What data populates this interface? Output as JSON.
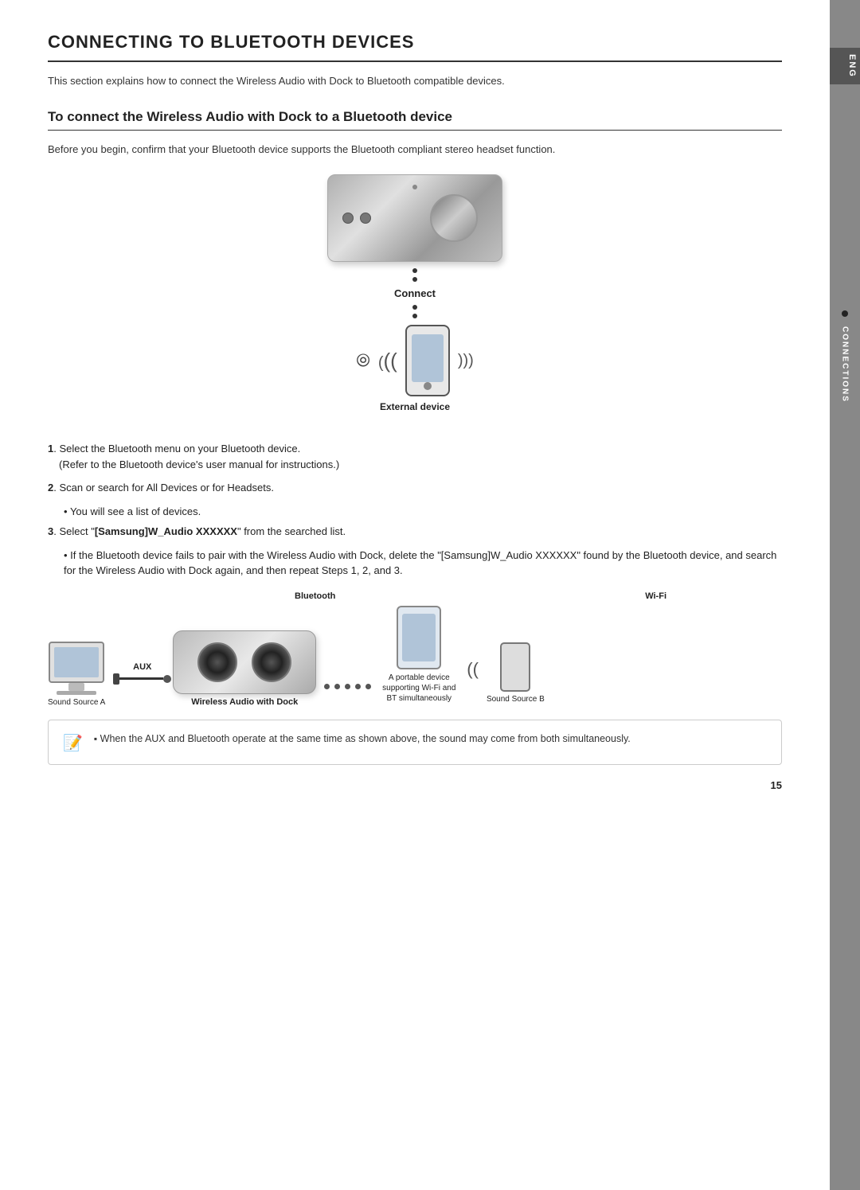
{
  "page": {
    "title": "CONNECTING TO BLUETOOTH DEVICES",
    "intro": "This section explains how to connect the Wireless Audio with Dock to Bluetooth compatible devices.",
    "section_heading": "To connect the Wireless Audio with Dock to a Bluetooth device",
    "before_text": "Before you begin, confirm that your Bluetooth device supports the Bluetooth compliant stereo headset function.",
    "diagram": {
      "connect_label": "Connect",
      "external_device_label": "External device"
    },
    "instructions": [
      {
        "num": "1",
        "text": "Select the Bluetooth menu on your Bluetooth device.",
        "sub": "(Refer to the Bluetooth device's user manual for instructions.)"
      },
      {
        "num": "2",
        "text": "Scan or search for All Devices or for Headsets.",
        "bullets": [
          "You will see a list of devices."
        ]
      },
      {
        "num": "3",
        "text": "Select \"[Samsung]W_Audio XXXXXX\" from the searched list.",
        "bold_part": "[Samsung]W_Audio XXXXXX",
        "bullets": [
          "If the Bluetooth device fails to pair with the Wireless Audio with Dock, delete the \"[Samsung]W_Audio XXXXXX\" found by the Bluetooth device, and search for the Wireless Audio with Dock again, and then repeat Steps 1, 2, and 3."
        ]
      }
    ],
    "bottom_diagram": {
      "aux_label": "AUX",
      "bluetooth_label": "Bluetooth",
      "wifi_label": "Wi-Fi",
      "sound_source_a": "Sound Source A",
      "sound_source_b": "Sound Source B",
      "wireless_audio_label": "Wireless Audio with Dock",
      "portable_device_label": "A portable device supporting Wi-Fi and BT simultaneously"
    },
    "note": {
      "bullet": "When the AUX and Bluetooth operate at the same time as shown above, the sound may come from both simultaneously."
    },
    "page_number": "15",
    "sidebar": {
      "eng_label": "ENG",
      "connections_label": "CONNECTIONS"
    }
  }
}
